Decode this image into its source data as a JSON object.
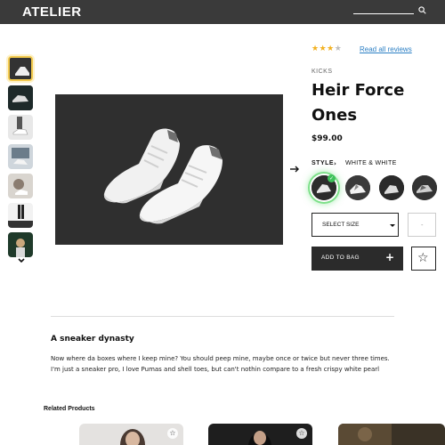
{
  "header": {
    "brand": "ATELIER",
    "search_icon": "search-icon"
  },
  "gallery": {
    "thumbnails": [
      {
        "name": "thumb-1",
        "selected": true
      },
      {
        "name": "thumb-2",
        "selected": false
      },
      {
        "name": "thumb-3",
        "selected": false
      },
      {
        "name": "thumb-4",
        "selected": false
      },
      {
        "name": "thumb-5",
        "selected": false
      },
      {
        "name": "thumb-6",
        "selected": false
      },
      {
        "name": "thumb-7",
        "selected": false
      }
    ],
    "scroll_icon": "chevron-down-icon",
    "next_icon": "arrow-right-icon"
  },
  "product": {
    "rating_value": 3,
    "rating_max": 4,
    "reviews_link": "Read all reviews",
    "category": "KICKS",
    "title": "Heir Force Ones",
    "price": "$99.00",
    "style_label": "STYLE",
    "style_chevron": "›",
    "style_value": "WHITE & WHITE",
    "swatches": [
      {
        "name": "swatch-white-white",
        "selected": true
      },
      {
        "name": "swatch-2",
        "selected": false
      },
      {
        "name": "swatch-3",
        "selected": false
      },
      {
        "name": "swatch-4",
        "selected": false
      }
    ],
    "size_select": "SELECT SIZE",
    "quantity": "-",
    "add_to_bag": "ADD TO BAG",
    "add_icon": "+",
    "favorite_icon": "☆"
  },
  "details": {
    "heading": "A sneaker dynasty",
    "body": "Now where da boxes where I keep mine? You should peep mine, maybe once or twice but never three times. I'm just a sneaker pro, I love Pumas and shell toes, but can't nothin compare to a fresh crispy white pearl"
  },
  "related": {
    "heading": "Related Products"
  },
  "colors": {
    "header_bg": "#3a3a3a",
    "accent_star": "#f2b01e",
    "link": "#2b7fc4",
    "selected_swatch_glow": "#3ec15a",
    "button_dark": "#2b2b2b"
  }
}
